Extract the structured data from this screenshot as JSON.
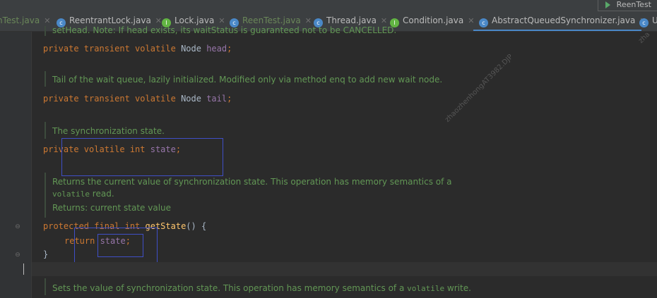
{
  "run_config": "ReenTest",
  "tabs": [
    {
      "label": "nTest.java",
      "icon_color": "#4a88c7",
      "label_color": "#6a8759"
    },
    {
      "label": "ReentrantLock.java",
      "icon_color": "#4a88c7",
      "label_color": "#bbbbbb"
    },
    {
      "label": "Lock.java",
      "icon_color": "#62b543",
      "label_color": "#bbbbbb"
    },
    {
      "label": "ReenTest.java",
      "icon_color": "#4a88c7",
      "label_color": "#6a8759"
    },
    {
      "label": "Thread.java",
      "icon_color": "#4a88c7",
      "label_color": "#bbbbbb"
    },
    {
      "label": "Condition.java",
      "icon_color": "#62b543",
      "label_color": "#bbbbbb"
    },
    {
      "label": "AbstractQueuedSynchronizer.java",
      "icon_color": "#4a88c7",
      "label_color": "#bbbbbb",
      "active": true
    },
    {
      "label": "U",
      "icon_color": "#4a88c7",
      "label_color": "#bbbbbb"
    }
  ],
  "doc": {
    "head_tail": "setHead. Note: If head exists, its waitStatus is guaranteed not to be CANCELLED.",
    "tail": "Tail of the wait queue, lazily initialized. Modified only via method enq to add new wait node.",
    "state": "The synchronization state.",
    "getstate_1": "Returns the current value of synchronization state. This operation has memory semantics of a",
    "getstate_2_code": "volatile",
    "getstate_2_text": " read.",
    "getstate_3": "Returns: current state value",
    "setstate_text": "Sets the value of synchronization state. This operation has memory semantics of a ",
    "setstate_code": "volatile",
    "setstate_end": " write."
  },
  "code": {
    "l1_mod": "private transient volatile ",
    "l1_type": "Node ",
    "l1_field": "head",
    "l1_end": ";",
    "l2_mod": "private transient volatile ",
    "l2_type": "Node ",
    "l2_field": "tail",
    "l2_end": ";",
    "l3_mod": "private volatile int ",
    "l3_field": "state",
    "l3_end": ";",
    "l4_mod": "protected final int ",
    "l4_method": "getState",
    "l4_end": "() {",
    "l5_kw": "return ",
    "l5_field": "state",
    "l5_end": ";",
    "l6": "}"
  },
  "watermark": {
    "name": "zhaozhenhong",
    "code": "AT3982.DJP",
    "corner": "zha"
  }
}
